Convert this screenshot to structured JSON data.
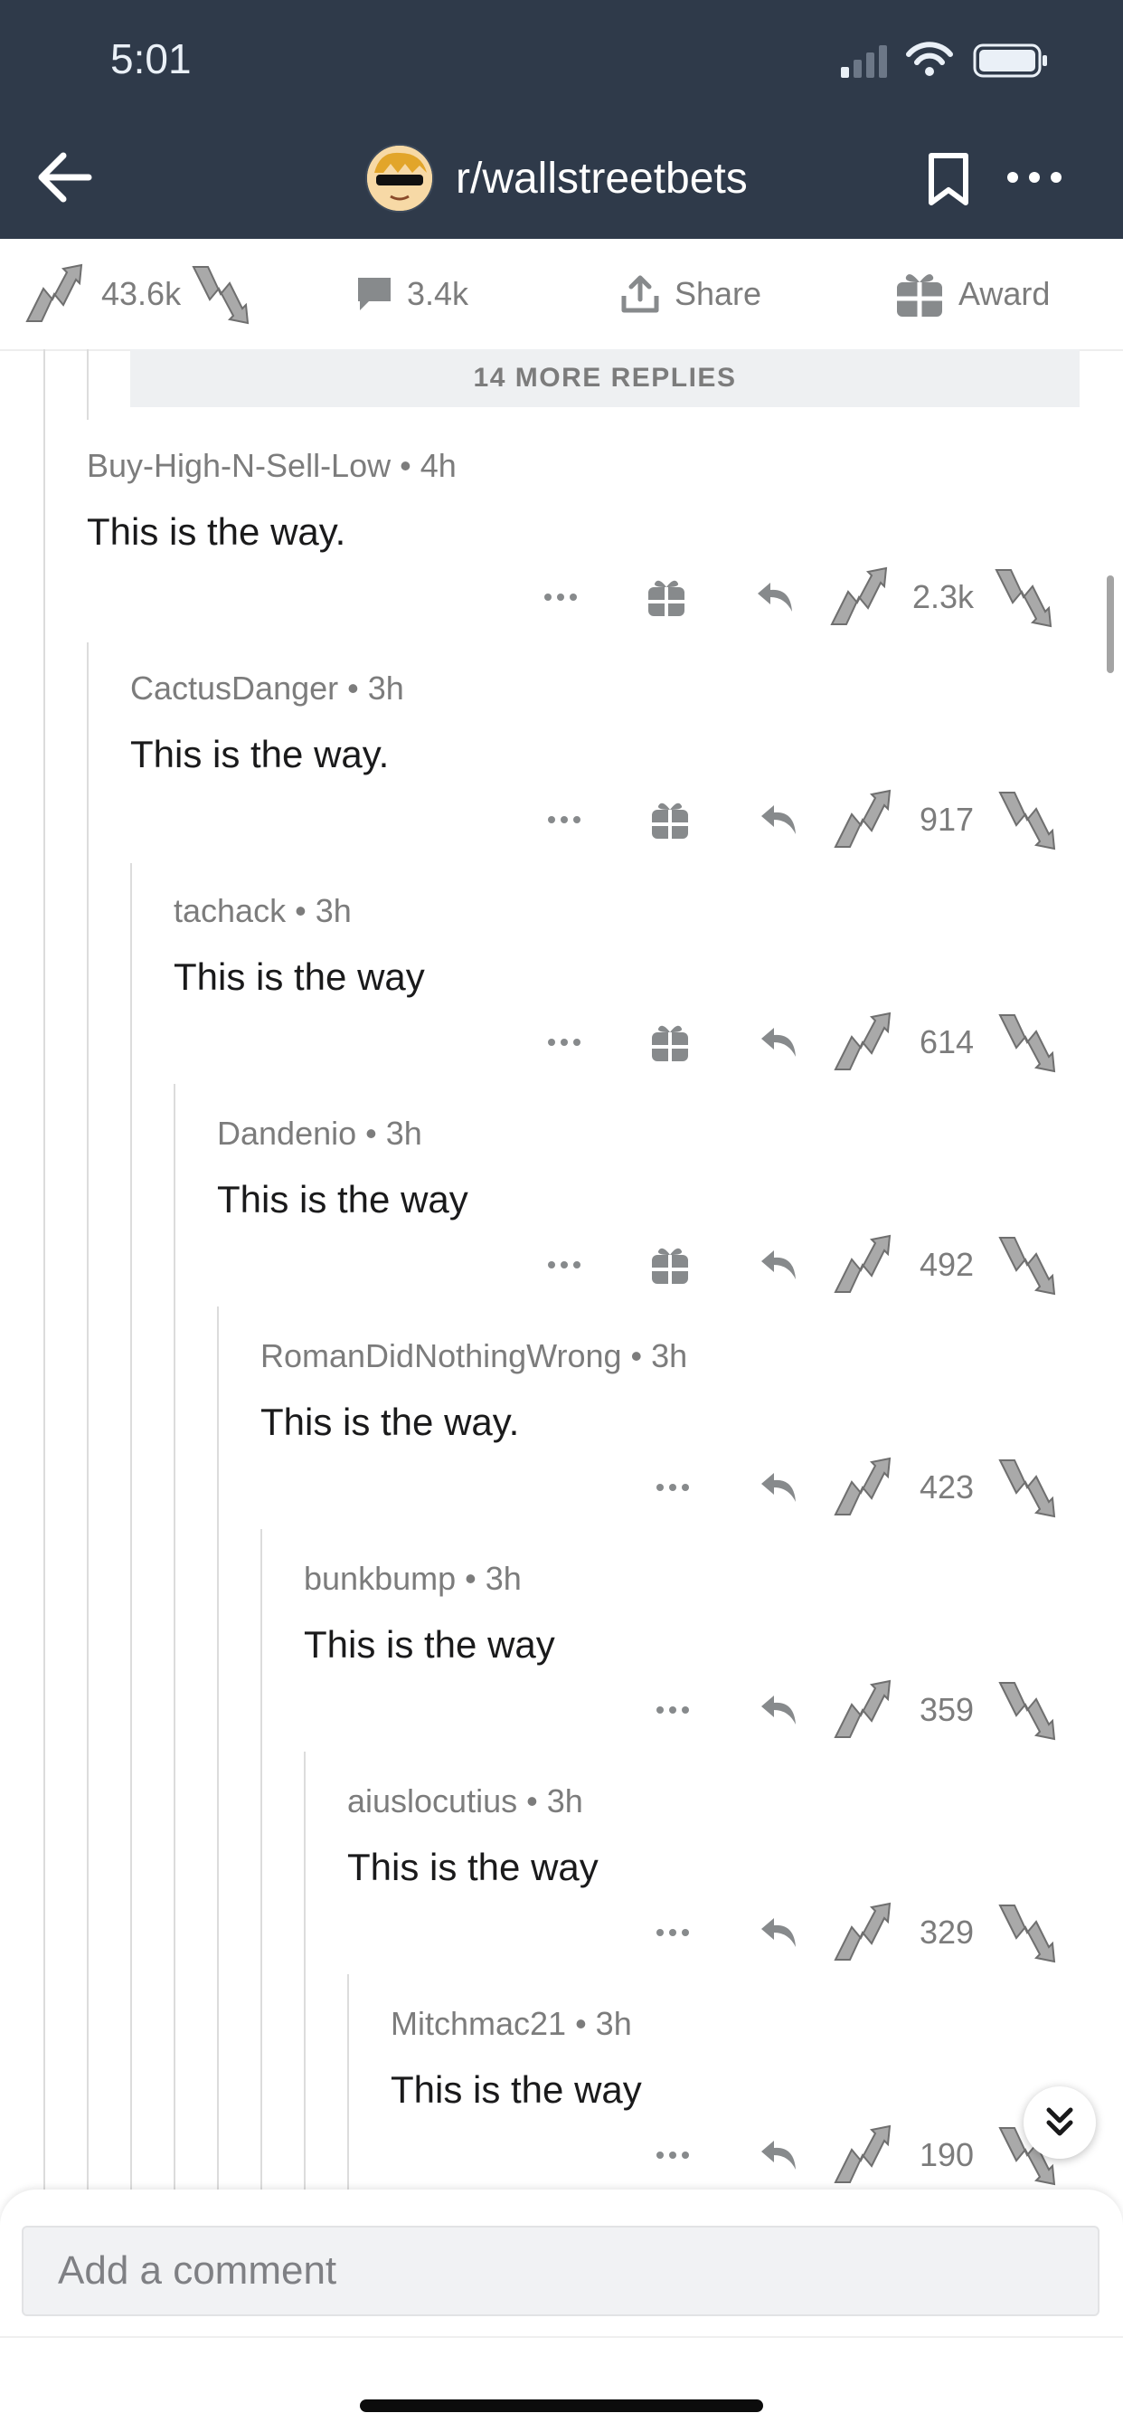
{
  "status_bar": {
    "time": "5:01"
  },
  "header": {
    "subreddit": "r/wallstreetbets"
  },
  "post_actions": {
    "upvotes": "43.6k",
    "comments": "3.4k",
    "share_label": "Share",
    "award_label": "Award"
  },
  "more_replies_label": "14 MORE REPLIES",
  "comments": [
    {
      "author": "Buy-High-N-Sell-Low",
      "time": "4h",
      "text": "This is the way.",
      "score": "2.3k"
    },
    {
      "author": "CactusDanger",
      "time": "3h",
      "text": "This is the way.",
      "score": "917"
    },
    {
      "author": "tachack",
      "time": "3h",
      "text": "This is the way",
      "score": "614"
    },
    {
      "author": "Dandenio",
      "time": "3h",
      "text": "This is the way",
      "score": "492"
    },
    {
      "author": "RomanDidNothingWrong",
      "time": "3h",
      "text": "This is the way.",
      "score": "423"
    },
    {
      "author": "bunkbump",
      "time": "3h",
      "text": "This is the way",
      "score": "359"
    },
    {
      "author": "aiuslocutius",
      "time": "3h",
      "text": "This is the way",
      "score": "329"
    },
    {
      "author": "Mitchmac21",
      "time": "3h",
      "text": "This is the way",
      "score": "190"
    }
  ],
  "comment_box": {
    "placeholder": "Add a comment"
  },
  "colors": {
    "header_bg": "#2f3a4a",
    "muted_text": "#7c7c7c",
    "divider": "#dcdcdc"
  },
  "icons": [
    "back-arrow-icon",
    "bookmark-icon",
    "more-icon",
    "upvote-icon",
    "downvote-icon",
    "comment-icon",
    "share-icon",
    "gift-icon",
    "reply-icon",
    "double-chevron-down-icon"
  ]
}
